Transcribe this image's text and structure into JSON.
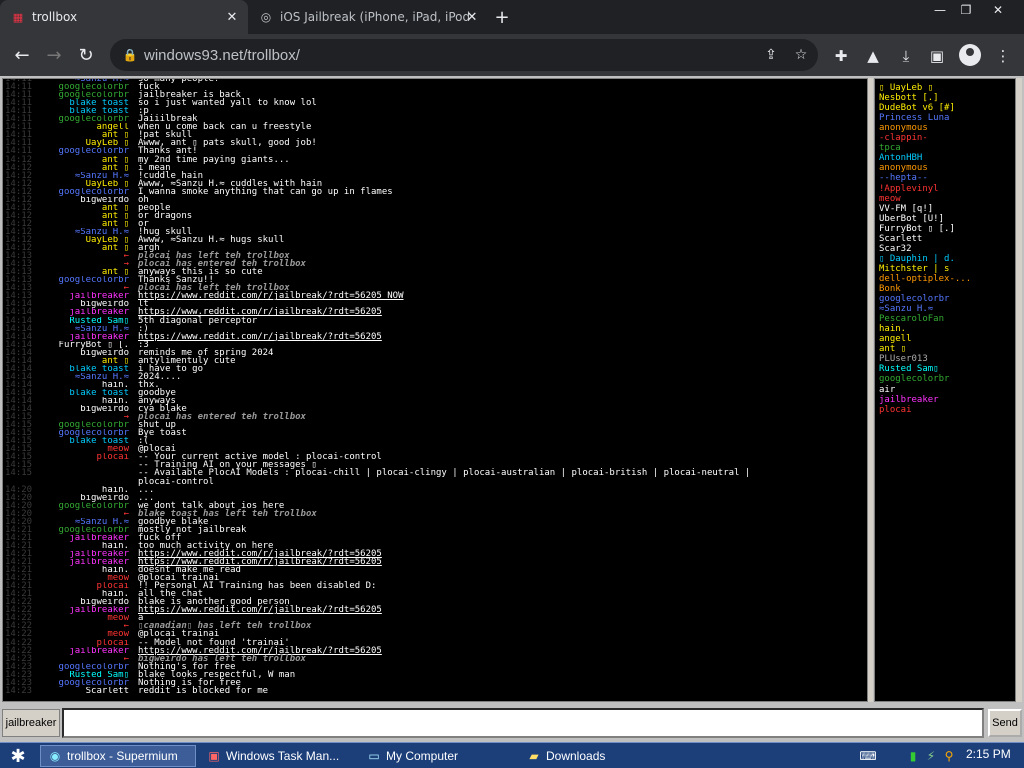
{
  "browser": {
    "tabs": [
      {
        "title": "trollbox",
        "active": true,
        "icon": "windows93-icon"
      },
      {
        "title": "iOS Jailbreak (iPhone, iPad, iPod To",
        "active": false,
        "icon": "reddit-icon"
      }
    ],
    "url": "windows93.net/trollbox/"
  },
  "colors": {
    "timestamp": "#3a3a3a",
    "blake toast": "#00ccff",
    "googlecolorbr": "#33aa33",
    "jailbreaker": "#ff33ff",
    "angell": "#ffee00",
    "ant": "#ffee00",
    "UayLeb": "#ffee00",
    "Sanzu": "#5577ff",
    "bigweirdo": "#ffffff",
    "system": "#ff3333",
    "Rusted": "#00ffff",
    "FurryBot": "#ffffff",
    "hain.": "#ffffff",
    "meow": "#ff3333",
    "plocai": "#ff3333",
    "Scarlett": "#ffffff"
  },
  "messages": [
    {
      "time": "14:11",
      "nick": "≈Sanzu H.≈",
      "text": "so many people!",
      "color": "#5577ff"
    },
    {
      "time": "14:11",
      "nick": "googlecolorbr",
      "text": "fuck",
      "color": "#33aa33"
    },
    {
      "time": "14:11",
      "nick": "googlecolorbr",
      "text": "jailbreaker is back",
      "color": "#33aa33"
    },
    {
      "time": "14:11",
      "nick": "blake toast",
      "text": "so i just wanted yall to know lol",
      "color": "#00ccff"
    },
    {
      "time": "14:11",
      "nick": "blake toast",
      "text": ":p",
      "color": "#00ccff"
    },
    {
      "time": "14:11",
      "nick": "googlecolorbr",
      "text": "Jaiiilbreak",
      "color": "#33aa33"
    },
    {
      "time": "14:11",
      "nick": "angell",
      "text": "when u come back can u freestyle",
      "color": "#ffee00"
    },
    {
      "time": "14:11",
      "nick": "ant ▯",
      "text": "!pat skull",
      "color": "#ffee00"
    },
    {
      "time": "14:11",
      "nick": "UayLeb ▯",
      "text": "Awww, ant ▯ pats skull, good job!",
      "color": "#ffee00"
    },
    {
      "time": "14:11",
      "nick": "googlecolorbr",
      "text": "Thanks ant!",
      "color": "#5577ff"
    },
    {
      "time": "14:12",
      "nick": "ant ▯",
      "text": "my 2nd time paying giants...",
      "color": "#ffee00"
    },
    {
      "time": "14:12",
      "nick": "ant ▯",
      "text": "i mean",
      "color": "#ffee00"
    },
    {
      "time": "14:12",
      "nick": "≈Sanzu H.≈",
      "text": "!cuddle hain",
      "color": "#5577ff"
    },
    {
      "time": "14:12",
      "nick": "UayLeb ▯",
      "text": "Awww, ≈Sanzu H.≈ cuddles with hain",
      "color": "#ffee00"
    },
    {
      "time": "14:12",
      "nick": "googlecolorbr",
      "text": "I wanna smoke anything that can go up in flames",
      "color": "#5577ff"
    },
    {
      "time": "14:12",
      "nick": "bigweirdo",
      "text": "oh",
      "color": "#ffffff"
    },
    {
      "time": "14:12",
      "nick": "ant ▯",
      "text": "people",
      "color": "#ffee00"
    },
    {
      "time": "14:12",
      "nick": "ant ▯",
      "text": "or dragons",
      "color": "#ffee00"
    },
    {
      "time": "14:12",
      "nick": "ant ▯",
      "text": "or",
      "color": "#ffee00"
    },
    {
      "time": "14:12",
      "nick": "≈Sanzu H.≈",
      "text": "!hug skull",
      "color": "#5577ff"
    },
    {
      "time": "14:12",
      "nick": "UayLeb ▯",
      "text": "Awww, ≈Sanzu H.≈ hugs skull",
      "color": "#ffee00"
    },
    {
      "time": "14:12",
      "nick": "ant ▯",
      "text": "argh",
      "color": "#ffee00"
    },
    {
      "time": "14:13",
      "nick": "←",
      "text": "plocai has left teh trollbox",
      "color": "#ff3333",
      "sys": true
    },
    {
      "time": "14:13",
      "nick": "→",
      "text": "plocai has entered teh trollbox",
      "color": "#ff3333",
      "sys": true
    },
    {
      "time": "14:13",
      "nick": "ant ▯",
      "text": "anyways this is so cute",
      "color": "#ffee00"
    },
    {
      "time": "14:13",
      "nick": "googlecolorbr",
      "text": "Thanks Sanzu!!",
      "color": "#5577ff"
    },
    {
      "time": "14:13",
      "nick": "←",
      "text": "plocai has left teh trollbox",
      "color": "#ff3333",
      "sys": true
    },
    {
      "time": "14:13",
      "nick": "jailbreaker",
      "text": "https://www.reddit.com/r/jailbreak/?rdt=56205 NOW",
      "color": "#ff33ff",
      "link": true
    },
    {
      "time": "14:14",
      "nick": "bigweirdo",
      "text": "lt",
      "color": "#ffffff"
    },
    {
      "time": "14:14",
      "nick": "jailbreaker",
      "text": "https://www.reddit.com/r/jailbreak/?rdt=56205",
      "color": "#ff33ff",
      "link": true
    },
    {
      "time": "14:14",
      "nick": "Rusted Sam▯",
      "text": "5th diagonal perceptor",
      "color": "#00ffff"
    },
    {
      "time": "14:14",
      "nick": "≈Sanzu H.≈",
      "text": ":)",
      "color": "#5577ff"
    },
    {
      "time": "14:14",
      "nick": "jailbreaker",
      "text": "https://www.reddit.com/r/jailbreak/?rdt=56205",
      "color": "#ff33ff",
      "link": true
    },
    {
      "time": "14:14",
      "nick": "FurryBot ▯ [.",
      "text": ":3",
      "color": "#ffffff"
    },
    {
      "time": "14:14",
      "nick": "bigweirdo",
      "text": "reminds me of spring 2024",
      "color": "#ffffff"
    },
    {
      "time": "14:14",
      "nick": "ant ▯",
      "text": "antylimentuly cute",
      "color": "#ffee00"
    },
    {
      "time": "14:14",
      "nick": "blake toast",
      "text": "i have to go",
      "color": "#00ccff"
    },
    {
      "time": "14:14",
      "nick": "≈Sanzu H.≈",
      "text": "2024....",
      "color": "#5577ff"
    },
    {
      "time": "14:14",
      "nick": "hain.",
      "text": "thx.",
      "color": "#ffffff"
    },
    {
      "time": "14:14",
      "nick": "blake toast",
      "text": "goodbye",
      "color": "#00ccff"
    },
    {
      "time": "14:14",
      "nick": "hain.",
      "text": "anyways",
      "color": "#ffffff"
    },
    {
      "time": "14:14",
      "nick": "bigweirdo",
      "text": "cya blake",
      "color": "#ffffff"
    },
    {
      "time": "14:15",
      "nick": "→",
      "text": "plocai has entered teh trollbox",
      "color": "#ff3333",
      "sys": true
    },
    {
      "time": "14:15",
      "nick": "googlecolorbr",
      "text": "shut up",
      "color": "#33aa33"
    },
    {
      "time": "14:15",
      "nick": "googlecolorbr",
      "text": "Bye toast",
      "color": "#5577ff"
    },
    {
      "time": "14:15",
      "nick": "blake toast",
      "text": ":(",
      "color": "#00ccff"
    },
    {
      "time": "14:15",
      "nick": "meow",
      "text": "@plocai",
      "color": "#ff3333"
    },
    {
      "time": "14:15",
      "nick": "plocai",
      "text": "-- Your current active model : plocai-control",
      "color": "#ff3333"
    },
    {
      "time": "14:15",
      "nick": "",
      "text": "-- Training AI on your messages ▯",
      "color": "#ff3333"
    },
    {
      "time": "14:15",
      "nick": "",
      "text": "-- Available PlocAI Models : plocai-chill | plocai-clingy | plocai-australian | plocai-british | plocai-neutral |",
      "color": "#ff3333"
    },
    {
      "time": "",
      "nick": "",
      "text": "plocai-control",
      "color": "#ff3333"
    },
    {
      "time": "14:20",
      "nick": "hain.",
      "text": "...",
      "color": "#ffffff"
    },
    {
      "time": "14:20",
      "nick": "bigweirdo",
      "text": "...",
      "color": "#ffffff"
    },
    {
      "time": "14:20",
      "nick": "googlecolorbr",
      "text": "we dont talk about ios here",
      "color": "#33aa33"
    },
    {
      "time": "14:20",
      "nick": "←",
      "text": "blake toast has left teh trollbox",
      "color": "#ff3333",
      "sys": true
    },
    {
      "time": "14:20",
      "nick": "≈Sanzu H.≈",
      "text": "goodbye blake",
      "color": "#5577ff"
    },
    {
      "time": "14:21",
      "nick": "googlecolorbr",
      "text": "mostly not jailbreak",
      "color": "#33aa33"
    },
    {
      "time": "14:21",
      "nick": "jailbreaker",
      "text": "fuck off",
      "color": "#ff33ff"
    },
    {
      "time": "14:21",
      "nick": "hain.",
      "text": "too much activity on here",
      "color": "#ffffff"
    },
    {
      "time": "14:21",
      "nick": "jailbreaker",
      "text": "https://www.reddit.com/r/jailbreak/?rdt=56205",
      "color": "#ff33ff",
      "link": true
    },
    {
      "time": "14:21",
      "nick": "jailbreaker",
      "text": "https://www.reddit.com/r/jailbreak/?rdt=56205",
      "color": "#ff33ff",
      "link": true
    },
    {
      "time": "14:21",
      "nick": "hain.",
      "text": "doesnt make me read",
      "color": "#ffffff"
    },
    {
      "time": "14:21",
      "nick": "meow",
      "text": "@plocai trainai",
      "color": "#ff3333"
    },
    {
      "time": "14:21",
      "nick": "plocai",
      "text": "!! Personal AI Training has been disabled D:",
      "color": "#ff3333"
    },
    {
      "time": "14:21",
      "nick": "hain.",
      "text": "all the chat",
      "color": "#ffffff"
    },
    {
      "time": "14:22",
      "nick": "bigweirdo",
      "text": "blake is another good person",
      "color": "#ffffff"
    },
    {
      "time": "14:22",
      "nick": "jailbreaker",
      "text": "https://www.reddit.com/r/jailbreak/?rdt=56205",
      "color": "#ff33ff",
      "link": true
    },
    {
      "time": "14:22",
      "nick": "meow",
      "text": "a",
      "color": "#ff3333"
    },
    {
      "time": "14:22",
      "nick": "←",
      "text": "▯canadian▯ has left teh trollbox",
      "color": "#ff3333",
      "sys": true
    },
    {
      "time": "14:22",
      "nick": "meow",
      "text": "@plocai trainai",
      "color": "#ff3333"
    },
    {
      "time": "14:22",
      "nick": "plocai",
      "text": "-- Model not found 'trainai'",
      "color": "#ff3333"
    },
    {
      "time": "14:22",
      "nick": "jailbreaker",
      "text": "https://www.reddit.com/r/jailbreak/?rdt=56205",
      "color": "#ff33ff",
      "link": true
    },
    {
      "time": "14:23",
      "nick": "←",
      "text": "bigweirdo has left teh trollbox",
      "color": "#ff3333",
      "sys": true
    },
    {
      "time": "14:23",
      "nick": "googlecolorbr",
      "text": "Nothing's for free",
      "color": "#5577ff"
    },
    {
      "time": "14:23",
      "nick": "Rusted Sam▯",
      "text": "blake looks respectful, W man",
      "color": "#00ffff"
    },
    {
      "time": "14:23",
      "nick": "googlecolorbr",
      "text": "Nothing is for free",
      "color": "#5577ff"
    },
    {
      "time": "14:23",
      "nick": "Scarlett",
      "text": "reddit is blocked for me",
      "color": "#ffffff"
    }
  ],
  "users": [
    {
      "name": "▯ UayLeb ▯",
      "color": "#ffee00"
    },
    {
      "name": "Nesbott [.]",
      "color": "#ffee00"
    },
    {
      "name": "DudeBot v6 [#]",
      "color": "#ffee00"
    },
    {
      "name": "Princess Luna",
      "color": "#5577ff"
    },
    {
      "name": "anonymous",
      "color": "#ff9900"
    },
    {
      "name": "-clappin-",
      "color": "#ff3333"
    },
    {
      "name": "tpca",
      "color": "#33aa33"
    },
    {
      "name": "AntonHBH",
      "color": "#00ccff"
    },
    {
      "name": "anonymous",
      "color": "#ff9900"
    },
    {
      "name": "--hepta--",
      "color": "#5577ff"
    },
    {
      "name": "!Applevinyl",
      "color": "#ff3333"
    },
    {
      "name": "meow",
      "color": "#ff3333"
    },
    {
      "name": "VV-FM [q!]",
      "color": "#ffffff"
    },
    {
      "name": "UberBot [U!]",
      "color": "#ffffff"
    },
    {
      "name": "FurryBot ▯ [.]",
      "color": "#ffffff"
    },
    {
      "name": "Scarlett",
      "color": "#ffffff"
    },
    {
      "name": "Scar32",
      "color": "#ffffff"
    },
    {
      "name": "▯ Dauphin | d.",
      "color": "#00ccff"
    },
    {
      "name": "Mitchster | s",
      "color": "#ffee00"
    },
    {
      "name": "dell-optiplex-...",
      "color": "#ff9900"
    },
    {
      "name": "Bonk",
      "color": "#ff9900"
    },
    {
      "name": "googlecolorbr",
      "color": "#5577ff"
    },
    {
      "name": "≈Sanzu H.≈",
      "color": "#5577ff"
    },
    {
      "name": "PescaroloFan",
      "color": "#33aa33"
    },
    {
      "name": "hain.",
      "color": "#ffee00"
    },
    {
      "name": "angell",
      "color": "#ffee00"
    },
    {
      "name": "ant ▯",
      "color": "#ffee00"
    },
    {
      "name": "PLUser013",
      "color": "#aaaaaa"
    },
    {
      "name": "Rusted Sam▯",
      "color": "#00ffff"
    },
    {
      "name": "googlecolorbr",
      "color": "#33aa33"
    },
    {
      "name": "air",
      "color": "#ffffff"
    },
    {
      "name": "jailbreaker",
      "color": "#ff33ff"
    },
    {
      "name": "plocai",
      "color": "#ff3333"
    }
  ],
  "input": {
    "nick_label": "jailbreaker",
    "value": "",
    "send_label": "Send"
  },
  "taskbar": {
    "tasks": [
      {
        "label": "trollbox - Supermium",
        "icon": "browser-icon",
        "active": true
      },
      {
        "label": "Windows Task Man...",
        "icon": "task-manager-icon",
        "active": false
      },
      {
        "label": "My Computer",
        "icon": "computer-icon",
        "active": false
      },
      {
        "label": "Downloads",
        "icon": "folder-icon",
        "active": false
      }
    ],
    "clock": "2:15 PM"
  }
}
